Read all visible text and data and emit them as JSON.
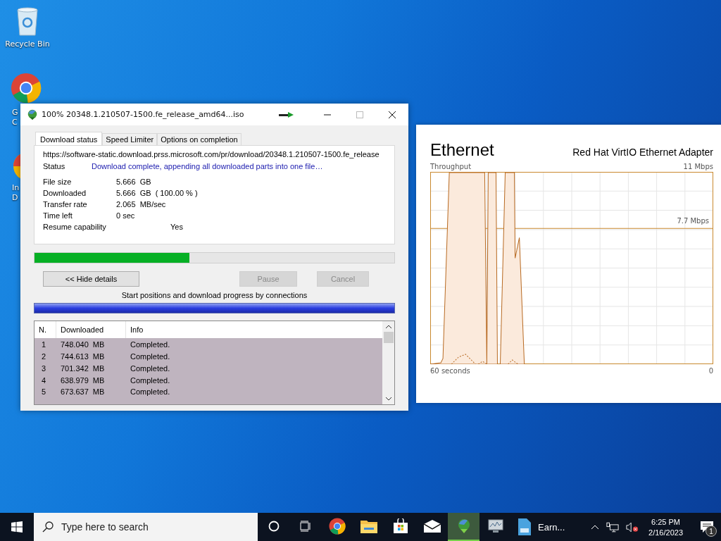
{
  "desktop_icons": [
    {
      "kind": "recycle",
      "lines": [
        "Recycle Bin"
      ]
    },
    {
      "kind": "chrome",
      "lines": [
        "G",
        "C"
      ]
    },
    {
      "kind": "idm",
      "lines": [
        "In",
        "D"
      ]
    }
  ],
  "download_window": {
    "title": "100% 20348.1.210507-1500.fe_release_amd64...iso",
    "tabs": [
      {
        "label": "Download status",
        "selected": true
      },
      {
        "label": "Speed Limiter",
        "selected": false
      },
      {
        "label": "Options on completion",
        "selected": false
      }
    ],
    "url": "https://software-static.download.prss.microsoft.com/pr/download/20348.1.210507-1500.fe_release",
    "status": {
      "label": "Status",
      "value": "Download complete, appending all downloaded parts into one file…"
    },
    "details": [
      {
        "label": "File size",
        "value": "5.666  GB"
      },
      {
        "label": "Downloaded",
        "value": "5.666  GB  ( 100.00 % )"
      },
      {
        "label": "Transfer rate",
        "value": "2.065  MB/sec"
      },
      {
        "label": "Time left",
        "value": "0 sec"
      },
      {
        "label": "Resume capability",
        "value": "Yes",
        "kind": "wide"
      }
    ],
    "progress": {
      "level": 0.43
    },
    "buttons": [
      {
        "label": "<< Hide details",
        "disabled": false
      },
      {
        "label": "Pause",
        "disabled": true
      },
      {
        "label": "Cancel",
        "disabled": true
      }
    ],
    "connections_caption": "Start positions and download progress by connections",
    "table": {
      "columns": [
        "N.",
        "Downloaded",
        "Info"
      ],
      "rows": [
        [
          "1",
          "748.040  MB",
          "Completed."
        ],
        [
          "2",
          "744.613  MB",
          "Completed."
        ],
        [
          "3",
          "701.342  MB",
          "Completed."
        ],
        [
          "4",
          "638.979  MB",
          "Completed."
        ],
        [
          "5",
          "673.637  MB",
          "Completed."
        ]
      ]
    }
  },
  "ethernet_panel": {
    "title": "Ethernet",
    "adapter": "Red Hat VirtIO Ethernet Adapter",
    "graph_label": "Throughput",
    "max_label": "11 Mbps",
    "mid_label": "7.7 Mbps",
    "time_label": "60 seconds",
    "min_label": "0"
  },
  "taskbar": {
    "search_placeholder": "Type here to search",
    "apps": [
      {
        "kind": "cortana",
        "active": false
      },
      {
        "kind": "taskview",
        "active": false
      },
      {
        "kind": "chrome",
        "active": false
      },
      {
        "kind": "explorer",
        "active": false
      },
      {
        "kind": "store",
        "active": false
      },
      {
        "kind": "mail",
        "active": false
      },
      {
        "kind": "idm",
        "active": true
      },
      {
        "kind": "monitor",
        "active": false
      }
    ],
    "doc_app": {
      "label": "Earn..."
    },
    "time": "6:25 PM",
    "date": "2/16/2023",
    "notification_count": "1"
  }
}
